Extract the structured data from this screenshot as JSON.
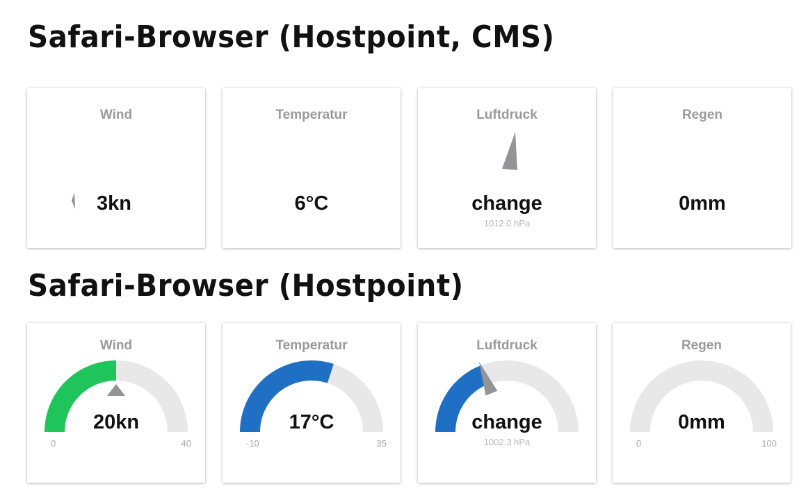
{
  "sections": [
    {
      "title": "Safari-Browser (Hostpoint, CMS)",
      "cards": [
        {
          "label": "Wind",
          "value": "3kn"
        },
        {
          "label": "Temperatur",
          "value": "6°C"
        },
        {
          "label": "Luftdruck",
          "value": "change",
          "sub": "1012.0 hPa"
        },
        {
          "label": "Regen",
          "value": "0mm"
        }
      ]
    },
    {
      "title": "Safari-Browser (Hostpoint)",
      "cards": [
        {
          "label": "Wind",
          "value": "20kn",
          "min": "0",
          "max": "40",
          "level": 0.5,
          "color": "#1fc55a",
          "pointer": true
        },
        {
          "label": "Temperatur",
          "value": "17°C",
          "min": "-10",
          "max": "35",
          "level": 0.6,
          "color": "#1f6fc4"
        },
        {
          "label": "Luftdruck",
          "value": "change",
          "sub": "1002.3 hPa",
          "level": 0.38,
          "color": "#1f6fc4",
          "needle": true
        },
        {
          "label": "Regen",
          "value": "0mm",
          "min": "0",
          "max": "100",
          "level": 0,
          "color": "#1f6fc4"
        }
      ]
    }
  ],
  "colors": {
    "track": "#e8e8e8",
    "pointer": "#949498",
    "label": "#9a9a9a"
  }
}
